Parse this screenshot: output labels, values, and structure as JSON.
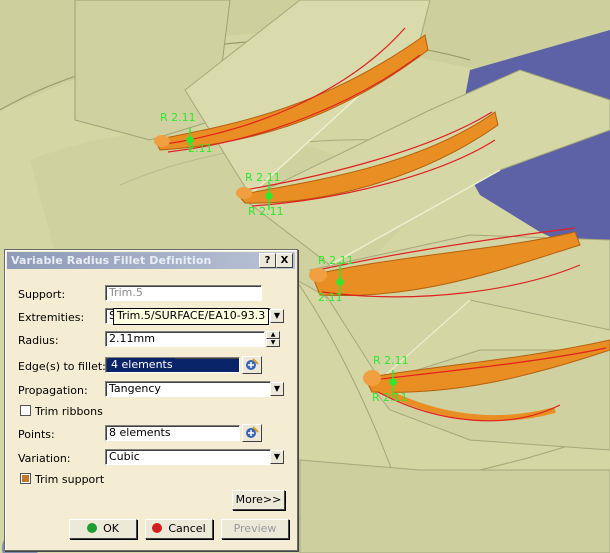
{
  "viewport": {
    "annotations": [
      {
        "label": "R 2.11"
      },
      {
        "label": "2.11"
      },
      {
        "label": "R 2.11"
      },
      {
        "label": "R 2.11"
      },
      {
        "label": "R 2.11"
      },
      {
        "label": "2.11"
      },
      {
        "label": "R 2.11"
      },
      {
        "label": "R 2.11"
      }
    ]
  },
  "dialog": {
    "title": "Variable Radius Fillet Definition",
    "help_button": "?",
    "close_button": "X",
    "support": {
      "label": "Support:",
      "value": "Trim.5"
    },
    "extremities": {
      "label": "Extremities:",
      "value": "S",
      "tooltip": "Trim.5/SURFACE/EA10-93.3"
    },
    "radius": {
      "label": "Radius:",
      "value": "2.11mm"
    },
    "edges": {
      "label": "Edge(s) to fillet:",
      "value": "4 elements"
    },
    "propagation": {
      "label": "Propagation:",
      "value": "Tangency"
    },
    "trim_ribbons": {
      "label": "Trim ribbons",
      "checked": false
    },
    "points": {
      "label": "Points:",
      "value": "8 elements"
    },
    "variation": {
      "label": "Variation:",
      "value": "Cubic"
    },
    "trim_support": {
      "label": "Trim support",
      "checked": true
    },
    "more_button": "More>>",
    "ok_button": "OK",
    "cancel_button": "Cancel",
    "preview_button": "Preview"
  },
  "colors": {
    "surface": "#d6d8a4",
    "blade": "#cfd3a2",
    "fillet": "#e2861e",
    "curve": "#e41f1f",
    "label": "#2ee82e",
    "sky": "#5c62a8"
  }
}
